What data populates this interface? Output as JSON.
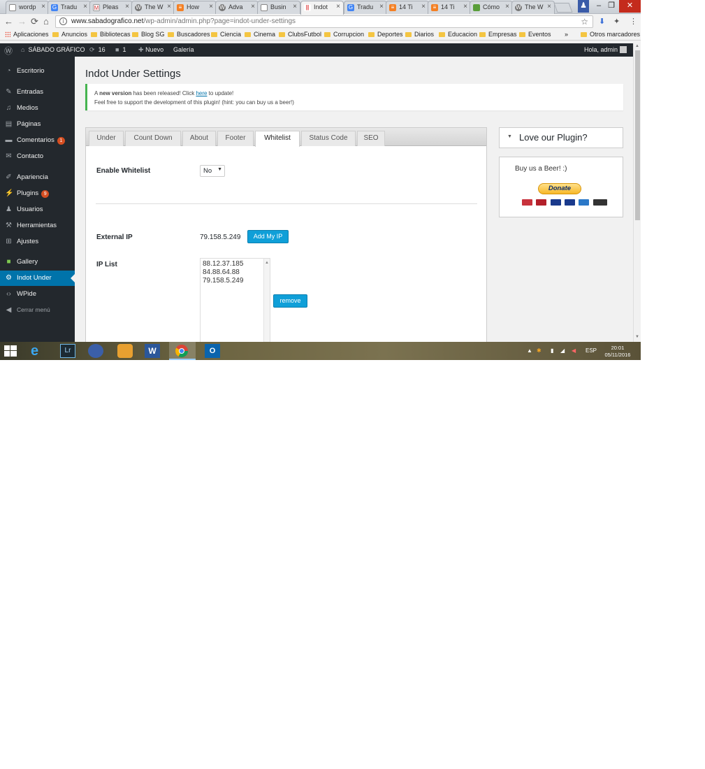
{
  "browser": {
    "tabs": [
      {
        "title": "wordp",
        "favicon": "page-icon"
      },
      {
        "title": "Tradu",
        "favicon": "translate-icon"
      },
      {
        "title": "Pleas",
        "favicon": "gmail-icon"
      },
      {
        "title": "The W",
        "favicon": "wordpress-icon"
      },
      {
        "title": "How",
        "favicon": "stackoverflow-icon"
      },
      {
        "title": "Adva",
        "favicon": "wordpress-icon"
      },
      {
        "title": "Busin",
        "favicon": "page-icon"
      },
      {
        "title": "Indot",
        "favicon": "plugin-icon"
      },
      {
        "title": "Tradu",
        "favicon": "translate-icon"
      },
      {
        "title": "14 Ti",
        "favicon": "stackoverflow-icon"
      },
      {
        "title": "14 Ti",
        "favicon": "stackoverflow-icon"
      },
      {
        "title": "Cómo",
        "favicon": "page-icon"
      },
      {
        "title": "The W",
        "favicon": "wordpress-icon"
      }
    ],
    "url_host": "www.sabadografico.net",
    "url_path": "/wp-admin/admin.php?page=indot-under-settings",
    "bookmarks": [
      "Aplicaciones",
      "Anuncios",
      "Bibliotecas",
      "Blog SG",
      "Buscadores",
      "Ciencia",
      "Cinema",
      "ClubsFutbol",
      "Corrupcion",
      "Deportes",
      "Diarios",
      "Educacion",
      "Empresas",
      "Eventos"
    ],
    "bookmarks_more": "»",
    "other_bookmarks": "Otros marcadores"
  },
  "adminbar": {
    "site_name": "SÁBADO GRÁFICO",
    "updates_count": "16",
    "comments_count": "1",
    "new_label": "Nuevo",
    "gallery_label": "Galería",
    "greeting": "Hola, admin"
  },
  "menu": {
    "items": [
      {
        "label": "Escritorio",
        "icon": "dashboard-icon"
      },
      {
        "label": "Entradas",
        "icon": "pin-icon"
      },
      {
        "label": "Medios",
        "icon": "media-icon"
      },
      {
        "label": "Páginas",
        "icon": "pages-icon"
      },
      {
        "label": "Comentarios",
        "icon": "comments-icon",
        "badge": "1"
      },
      {
        "label": "Contacto",
        "icon": "mail-icon"
      },
      {
        "label": "Apariencia",
        "icon": "brush-icon"
      },
      {
        "label": "Plugins",
        "icon": "plugin-icon",
        "badge": "9"
      },
      {
        "label": "Usuarios",
        "icon": "user-icon"
      },
      {
        "label": "Herramientas",
        "icon": "wrench-icon"
      },
      {
        "label": "Ajustes",
        "icon": "settings-icon"
      },
      {
        "label": "Gallery",
        "icon": "gallery-icon"
      },
      {
        "label": "Indot Under",
        "icon": "gear-icon"
      },
      {
        "label": "WPide",
        "icon": "code-icon"
      },
      {
        "label": "Cerrar menú",
        "icon": "collapse-icon"
      }
    ]
  },
  "page": {
    "title": "Indot Under Settings",
    "notice": {
      "line1_pre": "A ",
      "line1_bold": "new version",
      "line1_mid": " has been released! Click ",
      "line1_link": "here",
      "line1_post": " to update!",
      "line2": "Feel free to support the development of this plugin! (hint: you can buy us a beer!)"
    },
    "tabs": [
      "Under",
      "Count Down",
      "About",
      "Footer",
      "Whitelist",
      "Status Code",
      "SEO"
    ],
    "active_tab": "Whitelist",
    "enable_whitelist_label": "Enable Whitelist",
    "enable_whitelist_value": "No",
    "external_ip_label": "External IP",
    "external_ip_value": "79.158.5.249",
    "add_my_ip_label": "Add My IP",
    "ip_list_label": "IP List",
    "ip_list": [
      "88.12.37.185",
      "84.88.64.88",
      "79.158.5.249"
    ],
    "remove_label": "remove"
  },
  "sidebar": {
    "box_title": "Love our Plugin?",
    "buy_text": "Buy us a Beer! :)",
    "donate_label": "Donate"
  },
  "taskbar": {
    "language": "ESP",
    "time": "20:01",
    "date": "05/11/2016"
  },
  "colors": {
    "wp_dark": "#23282d",
    "wp_blue": "#0073aa",
    "button_blue": "#0f9fd8",
    "badge_orange": "#d54e21",
    "notice_green": "#46b450"
  }
}
